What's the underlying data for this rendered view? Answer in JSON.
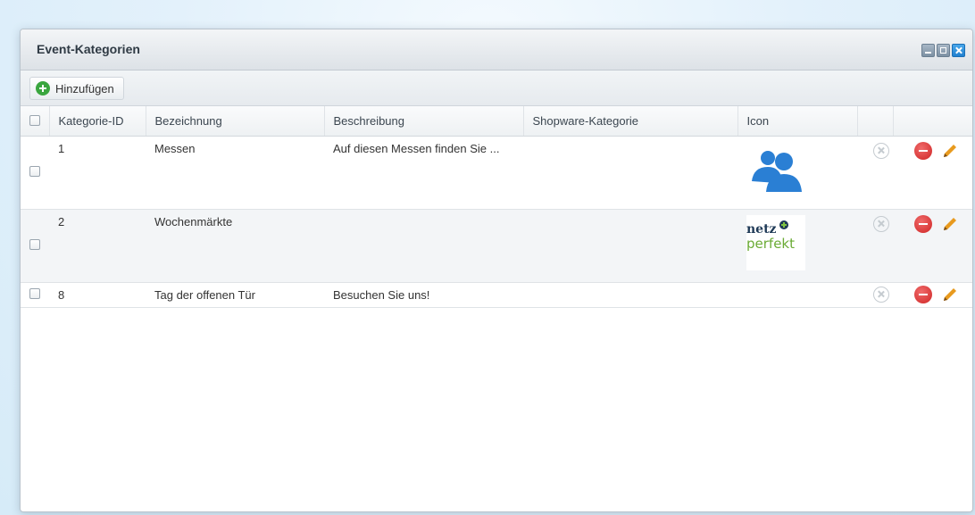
{
  "window": {
    "title": "Event-Kategorien"
  },
  "toolbar": {
    "add_label": "Hinzufügen"
  },
  "grid": {
    "columns": [
      "Kategorie-ID",
      "Bezeichnung",
      "Beschreibung",
      "Shopware-Kategorie",
      "Icon",
      "",
      ""
    ],
    "rows": [
      {
        "id": "1",
        "name": "Messen",
        "description": "Auf diesen Messen finden Sie ...",
        "shopware_category": "",
        "icon": "users-group-icon"
      },
      {
        "id": "2",
        "name": "Wochenmärkte",
        "description": "",
        "shopware_category": "",
        "icon": "netzperfekt-logo",
        "logo_line1": "netz",
        "logo_line2": "perfekt"
      },
      {
        "id": "8",
        "name": "Tag der offenen Tür",
        "description": "Besuchen Sie uns!",
        "shopware_category": "",
        "icon": ""
      }
    ]
  },
  "colors": {
    "accent_blue": "#2a7fd4",
    "delete_red": "#cf2525",
    "add_green": "#3aa63f",
    "edit_orange": "#e89a1e"
  }
}
